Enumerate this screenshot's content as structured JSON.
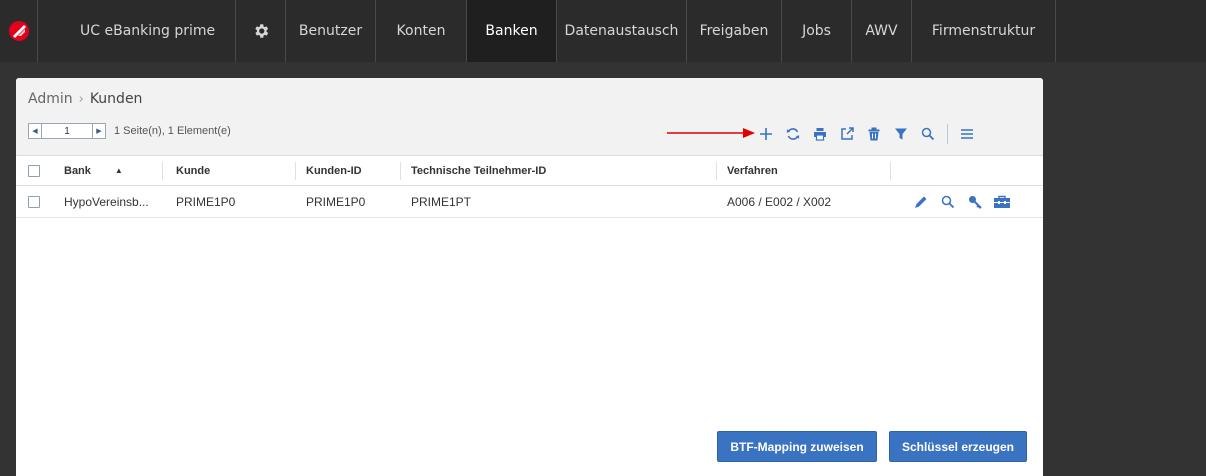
{
  "nav": {
    "app_title": "UC eBanking prime",
    "items": [
      {
        "label": "Benutzer",
        "active": false
      },
      {
        "label": "Konten",
        "active": false
      },
      {
        "label": "Banken",
        "active": true
      },
      {
        "label": "Datenaustausch",
        "active": false
      },
      {
        "label": "Freigaben",
        "active": false
      },
      {
        "label": "Jobs",
        "active": false
      },
      {
        "label": "AWV",
        "active": false
      },
      {
        "label": "Firmenstruktur",
        "active": false
      }
    ]
  },
  "breadcrumb": {
    "root": "Admin",
    "separator": "›",
    "current": "Kunden"
  },
  "pager": {
    "prev_icon": "◀",
    "page": "1",
    "next_icon": "▶",
    "info": "1 Seite(n), 1 Element(e)"
  },
  "toolbar": {
    "icons": [
      "add-icon",
      "refresh-icon",
      "print-icon",
      "export-icon",
      "delete-icon",
      "filter-icon",
      "search-icon",
      "menu-icon"
    ]
  },
  "table": {
    "columns": [
      "Bank",
      "Kunde",
      "Kunden-ID",
      "Technische Teilnehmer-ID",
      "Verfahren"
    ],
    "sort_indicator": "▲",
    "rows": [
      {
        "bank": "HypoVereinsb...",
        "kunde": "PRIME1P0",
        "kunden_id": "PRIME1P0",
        "teilnehmer_id": "PRIME1PT",
        "verfahren": "A006 / E002 / X002"
      }
    ]
  },
  "buttons": {
    "btf_mapping": "BTF-Mapping zuweisen",
    "generate_key": "Schlüssel erzeugen"
  },
  "colors": {
    "nav_bg": "#2b2b2b",
    "nav_active": "#1f1f1f",
    "accent": "#3a73c1",
    "icon": "#3a73c1",
    "arrow": "#e00000",
    "logo_red": "#e2001a"
  }
}
